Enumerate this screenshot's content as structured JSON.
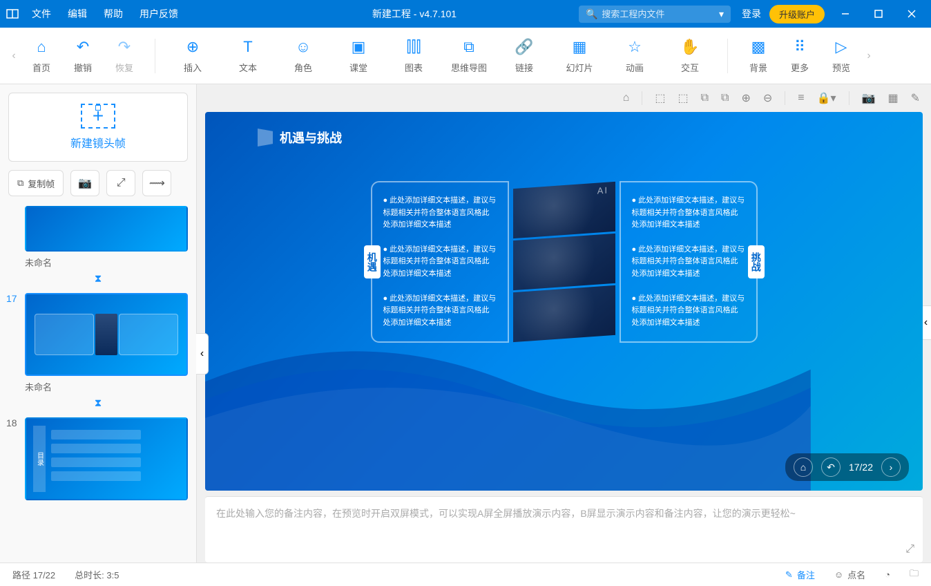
{
  "titlebar": {
    "menu": [
      "文件",
      "编辑",
      "帮助",
      "用户反馈"
    ],
    "title": "新建工程 - v4.7.101",
    "search_placeholder": "搜索工程内文件",
    "login": "登录",
    "upgrade": "升级账户"
  },
  "toolbar": {
    "items_left": [
      {
        "icon": "⌂",
        "label": "首页"
      },
      {
        "icon": "↶",
        "label": "撤销"
      },
      {
        "icon": "↷",
        "label": "恢复",
        "disabled": true
      }
    ],
    "items_main": [
      {
        "icon": "⊕",
        "label": "插入"
      },
      {
        "icon": "T",
        "label": "文本"
      },
      {
        "icon": "☺",
        "label": "角色"
      },
      {
        "icon": "▣",
        "label": "课堂"
      },
      {
        "icon": "⫿⫿⫿",
        "label": "图表"
      },
      {
        "icon": "⧉",
        "label": "思维导图"
      },
      {
        "icon": "🔗",
        "label": "链接"
      },
      {
        "icon": "▦",
        "label": "幻灯片"
      },
      {
        "icon": "☆",
        "label": "动画"
      },
      {
        "icon": "✋",
        "label": "交互"
      }
    ],
    "items_right": [
      {
        "icon": "▩",
        "label": "背景"
      },
      {
        "icon": "⠿",
        "label": "更多"
      },
      {
        "icon": "▷",
        "label": "预览"
      }
    ]
  },
  "sidebar": {
    "new_frame": "新建镜头帧",
    "copy_frame": "复制帧",
    "slides": [
      {
        "num": "",
        "label": "未命名",
        "partial": true
      },
      {
        "num": "17",
        "label": "未命名",
        "selected": true
      },
      {
        "num": "18",
        "label": ""
      }
    ]
  },
  "canvas": {
    "page_badge": "17",
    "slide_title": "机遇与挑战",
    "left_tab": "机遇",
    "right_tab": "挑战",
    "ai_label": "AI",
    "bullets": [
      "此处添加详细文本描述，建议与标题相关并符合整体语言风格此处添加详细文本描述",
      "此处添加详细文本描述，建议与标题相关并符合整体语言风格此处添加详细文本描述",
      "此处添加详细文本描述，建议与标题相关并符合整体语言风格此处添加详细文本描述"
    ],
    "nav_page": "17/22"
  },
  "notes": {
    "placeholder": "在此处输入您的备注内容，在预览时开启双屏模式，可以实现A屏全屏播放演示内容，B屏显示演示内容和备注内容，让您的演示更轻松~"
  },
  "statusbar": {
    "path": "路径 17/22",
    "duration": "总时长: 3:5",
    "notes": "备注",
    "roll": "点名"
  }
}
